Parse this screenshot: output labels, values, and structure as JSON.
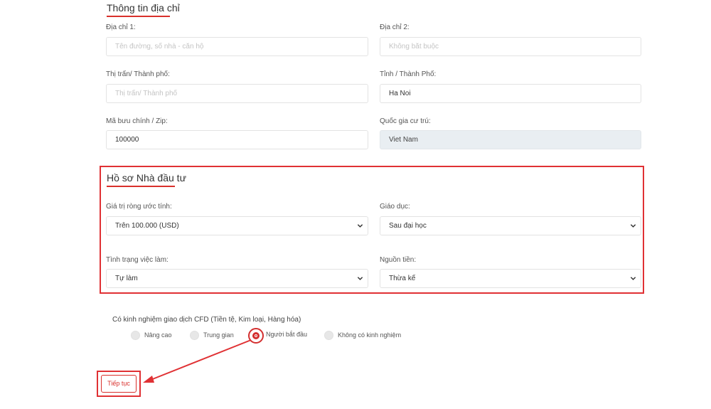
{
  "address_section": {
    "title": "Thông tin địa chỉ",
    "address1": {
      "label": "Địa chỉ 1:",
      "placeholder": "Tên đường, số nhà - căn hộ",
      "value": ""
    },
    "address2": {
      "label": "Địa chỉ 2:",
      "placeholder": "Không bắt buộc",
      "value": ""
    },
    "town": {
      "label": "Thị trấn/ Thành phố:",
      "placeholder": "Thị trấn/ Thành phố",
      "value": ""
    },
    "province": {
      "label": "Tỉnh / Thành Phố:",
      "value": "Ha Noi"
    },
    "zip": {
      "label": "Mã bưu chính / Zip:",
      "value": "100000"
    },
    "country": {
      "label": "Quốc gia cư trú:",
      "value": "Viet Nam"
    }
  },
  "investor_section": {
    "title": "Hồ sơ Nhà đầu tư",
    "net_worth": {
      "label": "Giá trị ròng ước tính:",
      "selected": "Trên 100.000 (USD)"
    },
    "education": {
      "label": "Giáo dục:",
      "selected": "Sau đại học"
    },
    "employment": {
      "label": "Tình trạng việc làm:",
      "selected": "Tự làm"
    },
    "funds_source": {
      "label": "Nguồn tiền:",
      "selected": "Thừa kế"
    }
  },
  "cfd_experience": {
    "question": "Có kinh nghiệm giao dịch CFD (Tiền tệ, Kim loại, Hàng hóa)",
    "options": [
      "Nâng cao",
      "Trung gian",
      "Người bắt đầu",
      "Không có kinh nghiệm"
    ],
    "selected": "Người bắt đầu"
  },
  "continue_button": {
    "label": "Tiếp tục"
  },
  "colors": {
    "accent": "#d9302c",
    "highlight": "#e03134",
    "disabled_bg": "#e9eef2"
  },
  "icons": {
    "select_arrow": "chevron-down-icon",
    "annotation": "arrow-icon"
  }
}
